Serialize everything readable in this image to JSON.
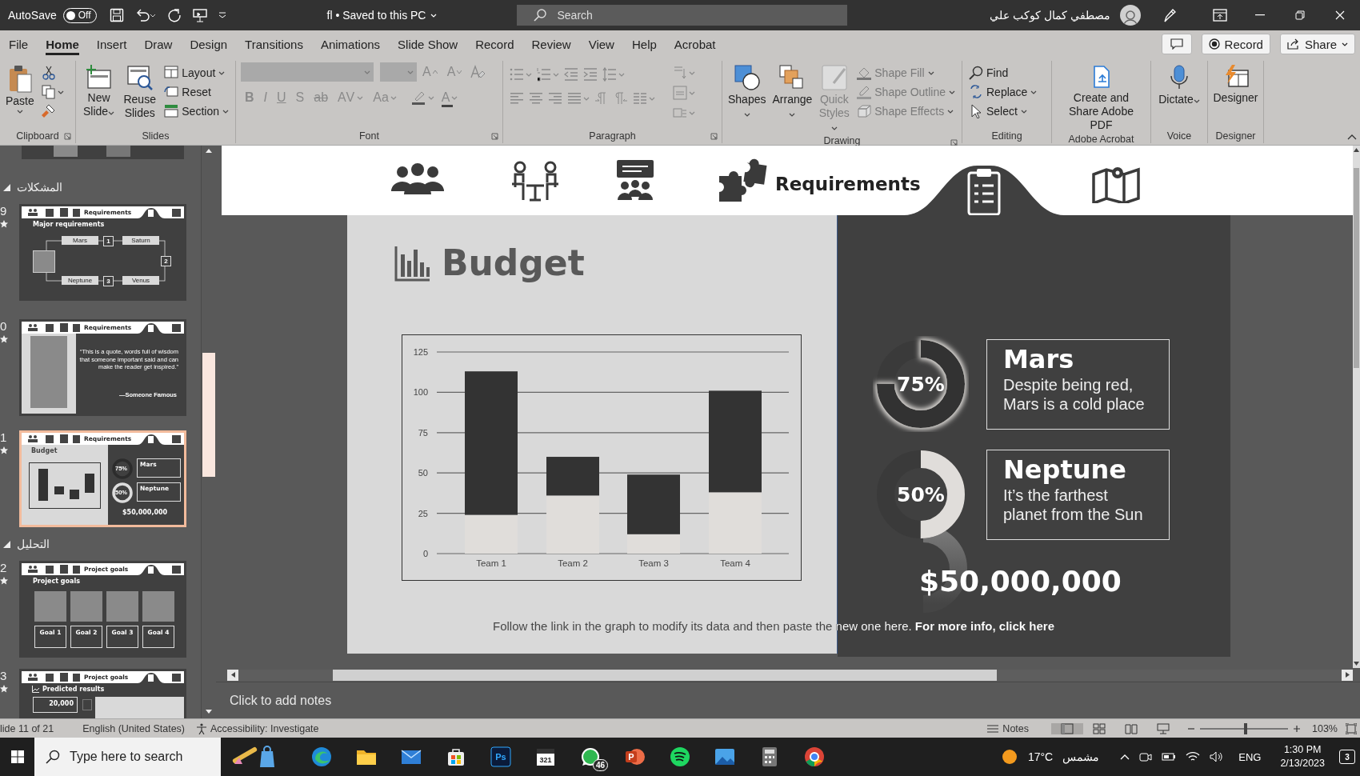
{
  "title_bar": {
    "autosave_label": "AutoSave",
    "autosave_on": false,
    "autosave_text": "Off",
    "document": "fl • Saved to this PC",
    "search_placeholder": "Search",
    "user_name": "مصطفي كمال كوكب علي"
  },
  "ribbon_tabs": [
    {
      "label": "File",
      "selected": false
    },
    {
      "label": "Home",
      "selected": true
    },
    {
      "label": "Insert",
      "selected": false
    },
    {
      "label": "Draw",
      "selected": false
    },
    {
      "label": "Design",
      "selected": false
    },
    {
      "label": "Transitions",
      "selected": false
    },
    {
      "label": "Animations",
      "selected": false
    },
    {
      "label": "Slide Show",
      "selected": false
    },
    {
      "label": "Record",
      "selected": false
    },
    {
      "label": "Review",
      "selected": false
    },
    {
      "label": "View",
      "selected": false
    },
    {
      "label": "Help",
      "selected": false
    },
    {
      "label": "Acrobat",
      "selected": false
    }
  ],
  "ribbon_actions": {
    "record": "Record",
    "share": "Share"
  },
  "ribbon_groups": [
    {
      "kind": "clipboard",
      "label": "Clipboard",
      "paste": "Paste"
    },
    {
      "kind": "slides",
      "label": "Slides",
      "large": [
        "New Slide",
        "Reuse Slides"
      ],
      "small": [
        "Layout",
        "Reset",
        "Section"
      ]
    },
    {
      "kind": "font",
      "label": "Font",
      "disabled": true,
      "size_buttons": [
        "A",
        "A"
      ],
      "format_buttons": [
        "B",
        "I",
        "U",
        "S",
        "ab",
        "AV",
        "Aa"
      ],
      "color_button": "A"
    },
    {
      "kind": "paragraph",
      "label": "Paragraph",
      "disabled": true
    },
    {
      "kind": "drawing",
      "label": "Drawing",
      "large": [
        {
          "label": "Shapes",
          "disabled": false
        },
        {
          "label": "Arrange",
          "disabled": false
        },
        {
          "label": "Quick Styles",
          "disabled": true
        }
      ],
      "small": [
        {
          "label": "Shape Fill",
          "disabled": true
        },
        {
          "label": "Shape Outline",
          "disabled": true
        },
        {
          "label": "Shape Effects",
          "disabled": true
        }
      ]
    },
    {
      "kind": "editing",
      "label": "Editing",
      "small": [
        "Find",
        "Replace",
        "Select"
      ]
    },
    {
      "kind": "acrobat",
      "label": "Adobe Acrobat",
      "button": "Create and Share Adobe PDF"
    },
    {
      "kind": "voice",
      "label": "Voice",
      "button": "Dictate"
    },
    {
      "kind": "designer",
      "label": "Designer",
      "button": "Designer"
    }
  ],
  "slide_panel": {
    "items": [
      {
        "kind": "slide_tail"
      },
      {
        "kind": "section",
        "title": "المشكلات",
        "expanded": true
      },
      {
        "kind": "diagram",
        "number": "9",
        "selected": false,
        "header": "Requirements",
        "title": "Major requirements",
        "nodes": [
          "Mars",
          "Saturn",
          "Neptune",
          "Venus"
        ],
        "steps": [
          "1",
          "2",
          "3"
        ]
      },
      {
        "kind": "quote",
        "number": "0",
        "selected": false,
        "header": "Requirements",
        "quote": "“This is a quote, words full of wisdom that someone important said and can make the reader get inspired.”",
        "author": "—Someone Famous"
      },
      {
        "kind": "budget",
        "number": "1",
        "selected": true,
        "header": "Requirements",
        "title": "Budget",
        "rings": [
          "75%",
          "50%"
        ],
        "cards": [
          "Mars",
          "Neptune"
        ],
        "amount": "$50,000,000"
      },
      {
        "kind": "section",
        "title": "التحليل",
        "expanded": true
      },
      {
        "kind": "goals",
        "number": "2",
        "selected": false,
        "header": "Project goals",
        "title": "Project goals",
        "goals": [
          "Goal 1",
          "Goal 2",
          "Goal 3",
          "Goal 4"
        ]
      },
      {
        "kind": "results",
        "number": "3",
        "selected": false,
        "header": "Project goals",
        "title": "Predicted results",
        "value": "20,000"
      }
    ]
  },
  "slide": {
    "header_label": "Requirements",
    "title": "Budget",
    "chart_data": {
      "type": "bar",
      "stacked": true,
      "grid": true,
      "categories": [
        "Team 1",
        "Team 2",
        "Team 3",
        "Team 4"
      ],
      "series": [
        {
          "color": "#e0ddda",
          "values": [
            24,
            36,
            12,
            38
          ]
        },
        {
          "color": "#333333",
          "values": [
            89,
            24,
            37,
            63
          ]
        }
      ],
      "ylim": [
        0,
        125
      ],
      "yticks": [
        0,
        25,
        50,
        75,
        100,
        125
      ]
    },
    "metrics": [
      {
        "value": "75%",
        "level": 0.75,
        "title": "Mars",
        "text": "Despite being red, Mars is a cold place"
      },
      {
        "value": "50%",
        "level": 0.5,
        "title": "Neptune",
        "text": "It’s the farthest planet from the Sun"
      }
    ],
    "amount": "$50,000,000",
    "footer_text": "Follow the link in the graph to modify its data and then paste the new one here.",
    "footer_link": "For more info, click here"
  },
  "notes": {
    "placeholder": "Click to add notes"
  },
  "status_bar": {
    "slide_counter": "lide 11 of 21",
    "language": "English (United States)",
    "accessibility": "Accessibility: Investigate",
    "notes": "Notes",
    "zoom_slider": {
      "level": 0.52
    },
    "zoom": "103%"
  },
  "taskbar": {
    "search_placeholder": "Type here to search",
    "pinned": [
      {
        "kind": "widgets"
      },
      {
        "kind": "edge"
      },
      {
        "kind": "folder"
      },
      {
        "kind": "mail"
      },
      {
        "kind": "store"
      },
      {
        "kind": "photoshop",
        "label": "Ps"
      },
      {
        "kind": "calendar",
        "label": "321"
      },
      {
        "kind": "whatsapp",
        "badge": "46"
      },
      {
        "kind": "powerpoint",
        "label": "P"
      },
      {
        "kind": "spotify"
      },
      {
        "kind": "photos"
      },
      {
        "kind": "calculator"
      },
      {
        "kind": "chrome"
      }
    ],
    "temperature": "17°C",
    "weather": "مشمس",
    "language": "ENG",
    "time": "1:30 PM",
    "date": "2/13/2023",
    "notifications": "3"
  }
}
